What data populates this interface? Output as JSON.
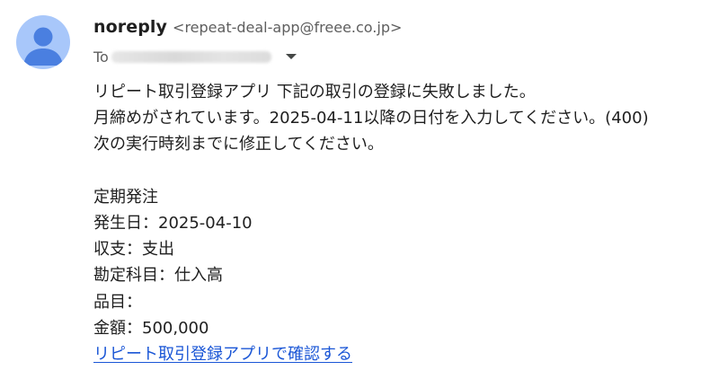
{
  "sender": {
    "name": "noreply",
    "email": "<repeat-deal-app@freee.co.jp>"
  },
  "recipient": {
    "label": "To"
  },
  "message": {
    "intro_lines": [
      "リピート取引登録アプリ 下記の取引の登録に失敗しました。",
      "月締めがされています。2025-04-11以降の日付を入力してください。(400)",
      "次の実行時刻までに修正してください。"
    ],
    "detail_lines": [
      "定期発注",
      "発生日：2025-04-10",
      "収支：支出",
      "勘定科目：仕入高",
      "品目：",
      "金額：500,000"
    ],
    "link_text": "リピート取引登録アプリで確認する"
  },
  "icons": {
    "avatar": "person-avatar-icon",
    "expand": "caret-down-icon"
  },
  "colors": {
    "avatar_bg": "#a8c7fa",
    "avatar_fg": "#4a7fe0",
    "link": "#1a56d6",
    "secondary_text": "#5e5e5e"
  }
}
